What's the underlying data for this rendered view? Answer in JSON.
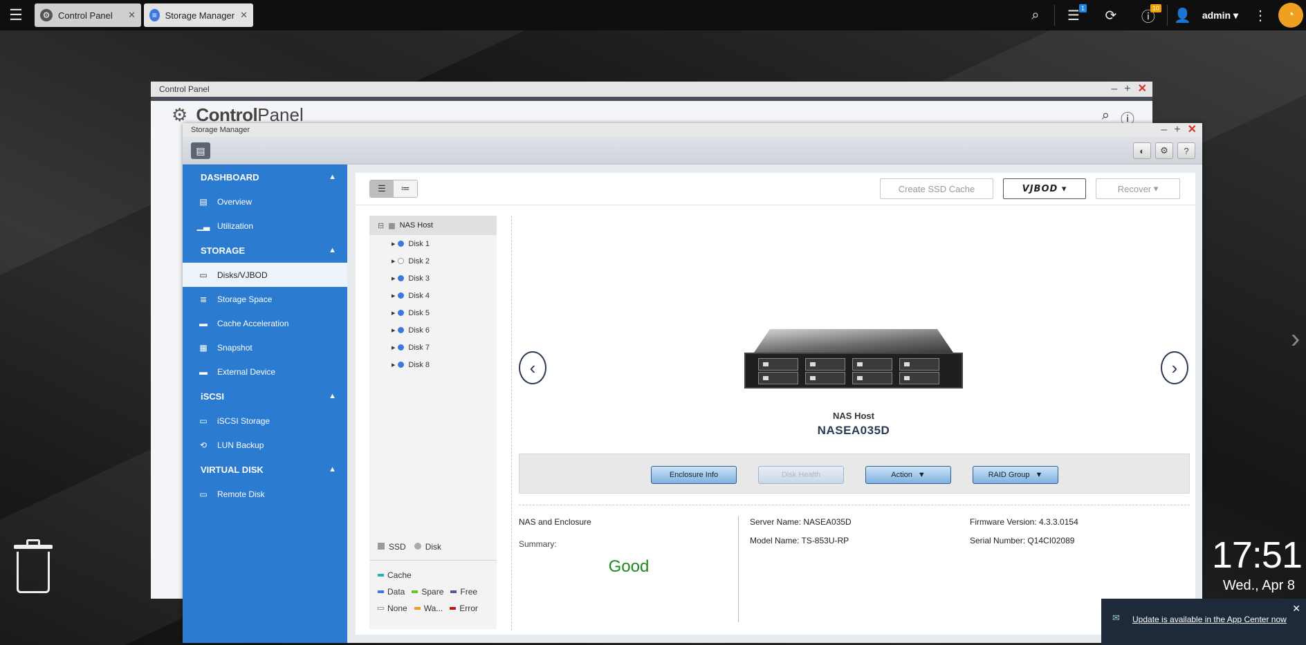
{
  "taskbar": {
    "tabs": [
      {
        "label": "Control Panel",
        "icon": "gear-icon"
      },
      {
        "label": "Storage Manager",
        "icon": "database-icon"
      }
    ],
    "notification_badge": "1",
    "info_badge": "10",
    "user": "admin"
  },
  "control_panel": {
    "window_title": "Control Panel",
    "header_light": "Control",
    "header_bold": "Panel"
  },
  "storage_manager": {
    "window_title": "Storage Manager",
    "sidebar": {
      "sections": [
        {
          "label": "DASHBOARD",
          "items": [
            "Overview",
            "Utilization"
          ]
        },
        {
          "label": "STORAGE",
          "items": [
            "Disks/VJBOD",
            "Storage Space",
            "Cache Acceleration",
            "Snapshot",
            "External Device"
          ]
        },
        {
          "label": "iSCSI",
          "items": [
            "iSCSI Storage",
            "LUN Backup"
          ]
        },
        {
          "label": "VIRTUAL DISK",
          "items": [
            "Remote Disk"
          ]
        }
      ],
      "active_item": "Disks/VJBOD"
    },
    "toolbar": {
      "create_ssd_cache": "Create SSD Cache",
      "vjbod": "VJBOD",
      "recover": "Recover"
    },
    "tree": {
      "root": "NAS Host",
      "disks": [
        "Disk 1",
        "Disk 2",
        "Disk 3",
        "Disk 4",
        "Disk 5",
        "Disk 6",
        "Disk 7",
        "Disk 8"
      ],
      "legend_type": [
        "SSD",
        "Disk"
      ],
      "legend_status": [
        "Cache",
        "Data",
        "Spare",
        "Free",
        "None",
        "Wa...",
        "Error"
      ]
    },
    "device": {
      "label": "NAS Host",
      "name": "NASEA035D"
    },
    "actions": {
      "enclosure_info": "Enclosure Info",
      "disk_health": "Disk Health",
      "action": "Action",
      "raid_group": "RAID Group"
    },
    "info": {
      "title": "NAS and Enclosure",
      "summary_label": "Summary:",
      "status": "Good",
      "server_name": "Server Name: NASEA035D",
      "model_name": "Model Name: TS-853U-RP",
      "firmware": "Firmware Version: 4.3.3.0154",
      "serial": "Serial Number: Q14CI02089"
    }
  },
  "desktop": {
    "time": "17:51",
    "date": "Wed., Apr 8"
  },
  "notification": {
    "text": "Update is available in the App Center now"
  },
  "colors": {
    "sidebar": "#2b7bd0",
    "status_good": "#1c8a1c",
    "close_red": "#d9302a"
  }
}
